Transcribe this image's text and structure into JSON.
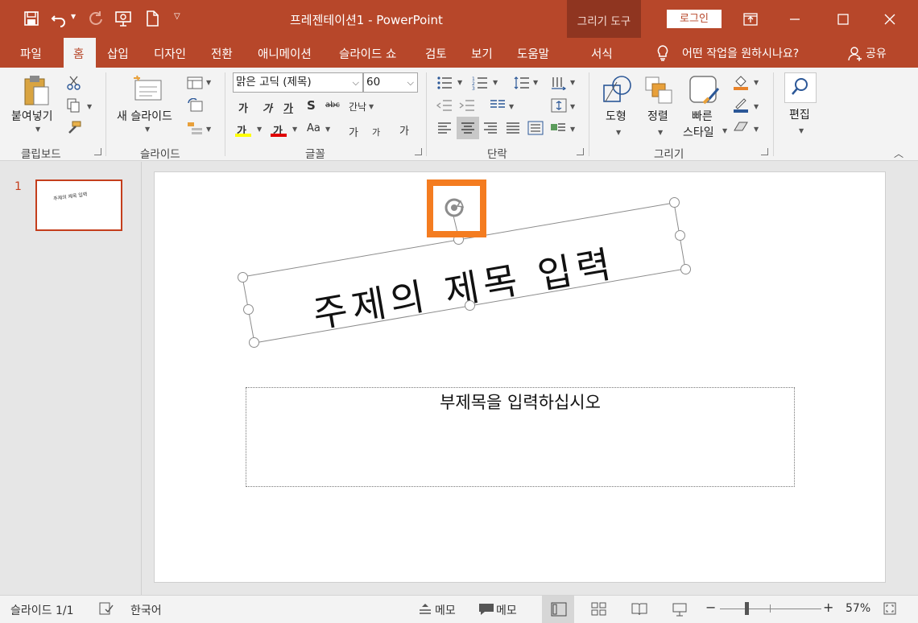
{
  "app": {
    "title": "프레젠테이션1  -  PowerPoint",
    "context_tool": "그리기 도구",
    "login_label": "로그인"
  },
  "tabs": [
    "파일",
    "홈",
    "삽입",
    "디자인",
    "전환",
    "애니메이션",
    "슬라이드 쇼",
    "검토",
    "보기",
    "도움말",
    "서식"
  ],
  "tell_me": "어떤 작업을 원하시나요?",
  "share": "공유",
  "ribbon": {
    "clipboard": {
      "paste": "붙여넣기",
      "group": "클립보드"
    },
    "slides": {
      "new_slide": "새 슬라이드",
      "group": "슬라이드"
    },
    "font": {
      "font_name": "맑은 고딕 (제목)",
      "font_size": "60",
      "bold": "가",
      "italic": "가",
      "underline": "가",
      "shadow": "S",
      "strike": "abc",
      "spacing": "간낙",
      "highlight": "가",
      "color": "가",
      "case": "Aa",
      "grow": "가",
      "shrink": "가",
      "clear": "가",
      "group": "글꼴"
    },
    "paragraph": {
      "group": "단락"
    },
    "drawing": {
      "shapes": "도형",
      "arrange": "정렬",
      "quick_styles_1": "빠른",
      "quick_styles_2": "스타일",
      "group": "그리기"
    },
    "editing": {
      "edit": "편집"
    }
  },
  "thumbnails": [
    {
      "number": "1",
      "title": "주제의 제목 입력"
    }
  ],
  "slide": {
    "title_placeholder": "주제의 제목 입력",
    "subtitle_placeholder": "부제목을 입력하십시오"
  },
  "status": {
    "slide_count": "슬라이드 1/1",
    "language": "한국어",
    "notes": "메모",
    "comments": "메모",
    "zoom": "57%"
  },
  "colors": {
    "accent": "#b7472a",
    "highlight": "#f47c20"
  }
}
